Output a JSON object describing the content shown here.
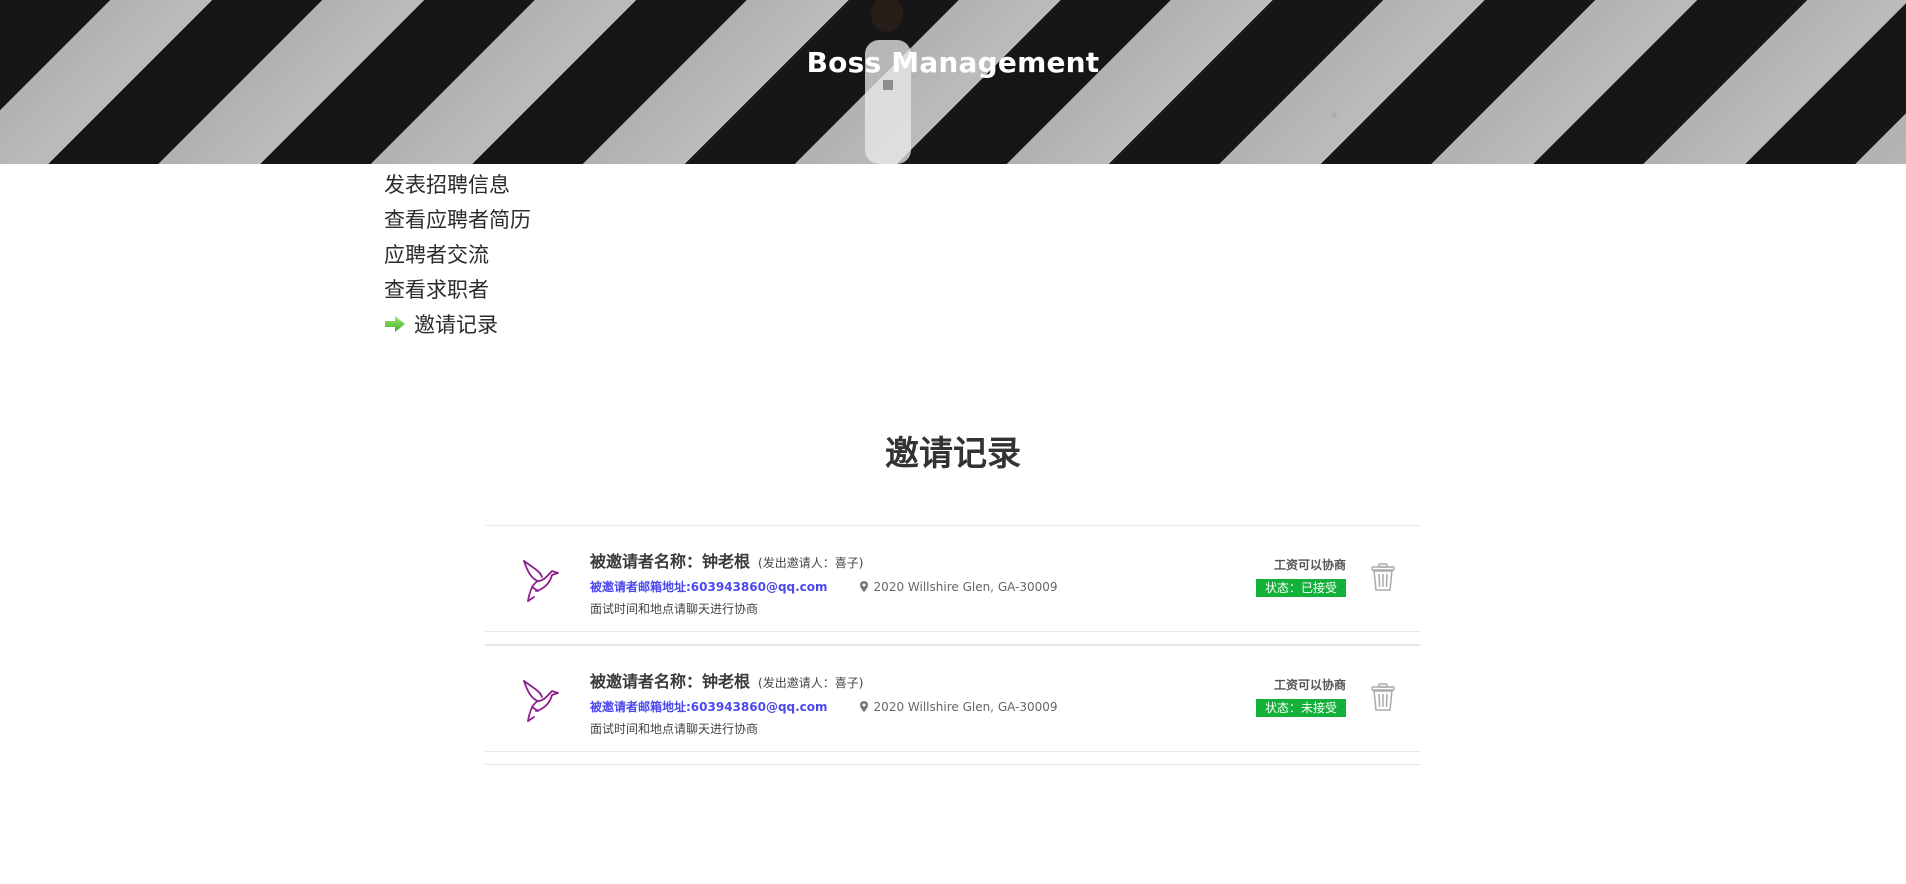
{
  "header": {
    "title": "Boss Management"
  },
  "menu": {
    "items": [
      {
        "label": "发表招聘信息",
        "active": false
      },
      {
        "label": "查看应聘者简历",
        "active": false
      },
      {
        "label": "应聘者交流",
        "active": false
      },
      {
        "label": "查看求职者",
        "active": false
      },
      {
        "label": "邀请记录",
        "active": true,
        "icon": "arrow-right-icon"
      }
    ]
  },
  "section": {
    "title": "邀请记录"
  },
  "invitations": [
    {
      "avatar_icon": "bird-icon",
      "name_label": "被邀请者名称：钟老根",
      "sender": "(发出邀请人：喜子)",
      "email": "被邀请者邮箱地址:603943860@qq.com",
      "address": "2020 Willshire Glen, GA-30009",
      "note": "面试时间和地点请聊天进行协商",
      "salary": "工资可以协商",
      "status": "状态：已接受",
      "status_color": "#13b13a"
    },
    {
      "avatar_icon": "bird-icon",
      "name_label": "被邀请者名称：钟老根",
      "sender": "(发出邀请人：喜子)",
      "email": "被邀请者邮箱地址:603943860@qq.com",
      "address": "2020 Willshire Glen, GA-30009",
      "note": "面试时间和地点请聊天进行协商",
      "salary": "工资可以协商",
      "status": "状态：未接受",
      "status_color": "#13b13a"
    }
  ],
  "colors": {
    "accent_email": "#4a4af0",
    "status_bg": "#13b13a",
    "bird": "#8b1f8f"
  }
}
